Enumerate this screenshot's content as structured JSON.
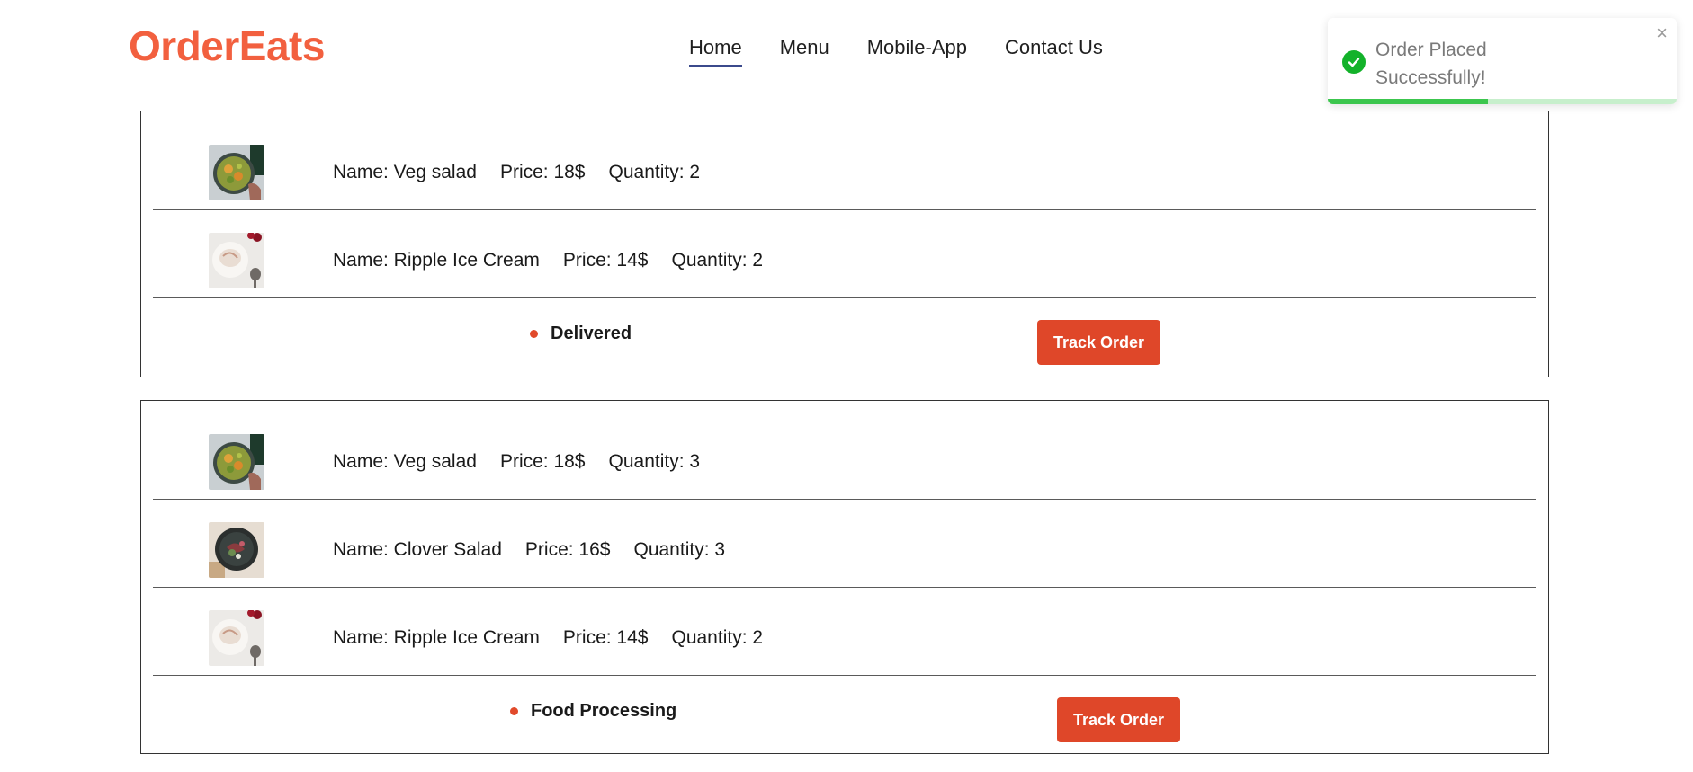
{
  "header": {
    "logo": "OrderEats",
    "nav": [
      {
        "label": "Home",
        "active": true
      },
      {
        "label": "Menu",
        "active": false
      },
      {
        "label": "Mobile-App",
        "active": false
      },
      {
        "label": "Contact Us",
        "active": false
      }
    ]
  },
  "toast": {
    "message": "Order Placed Successfully!",
    "close_icon": "close-icon",
    "status_icon": "check-circle-icon",
    "progress": 0.46,
    "colors": {
      "success": "#13b22a",
      "track": "#c7efcc",
      "fill": "#3cc64e"
    }
  },
  "colors": {
    "brand": "#f2603f",
    "button": "#df4729",
    "status_dot": "#e14a2b"
  },
  "orders": [
    {
      "items": [
        {
          "name": "Name: Veg salad",
          "price": "Price: 18$",
          "quantity": "Quantity: 2",
          "image": "veg-salad"
        },
        {
          "name": "Name: Ripple Ice Cream",
          "price": "Price: 14$",
          "quantity": "Quantity: 2",
          "image": "ripple-ice-cream"
        }
      ],
      "status": "Delivered",
      "button": "Track Order"
    },
    {
      "items": [
        {
          "name": "Name: Veg salad",
          "price": "Price: 18$",
          "quantity": "Quantity: 3",
          "image": "veg-salad"
        },
        {
          "name": "Name: Clover Salad",
          "price": "Price: 16$",
          "quantity": "Quantity: 3",
          "image": "clover-salad"
        },
        {
          "name": "Name: Ripple Ice Cream",
          "price": "Price: 14$",
          "quantity": "Quantity: 2",
          "image": "ripple-ice-cream"
        }
      ],
      "status": "Food Processing",
      "button": "Track Order"
    }
  ]
}
